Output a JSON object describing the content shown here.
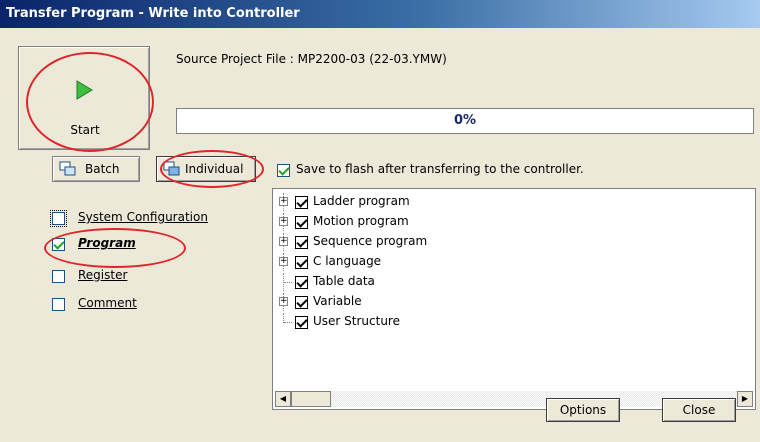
{
  "window": {
    "title": "Transfer Program - Write into Controller"
  },
  "start": {
    "label": "Start",
    "icon": "play-icon"
  },
  "source": {
    "text": "Source Project File : MP2200-03    (22-03.YMW)"
  },
  "progress": {
    "value_text": "0%",
    "value": 0
  },
  "modes": {
    "batch_label": "Batch",
    "individual_label": "Individual"
  },
  "save_to_flash": {
    "label": "Save to flash after transferring to the controller.",
    "checked": true
  },
  "side_items": [
    {
      "label": "System Configuration",
      "checked": false
    },
    {
      "label": "Program",
      "checked": true
    },
    {
      "label": "Register",
      "checked": false
    },
    {
      "label": "Comment",
      "checked": false
    }
  ],
  "tree": [
    {
      "label": "Ladder program",
      "expandable": true,
      "checked": true
    },
    {
      "label": "Motion program",
      "expandable": true,
      "checked": true
    },
    {
      "label": "Sequence program",
      "expandable": true,
      "checked": true
    },
    {
      "label": "C language",
      "expandable": true,
      "checked": true
    },
    {
      "label": "Table data",
      "expandable": false,
      "checked": true
    },
    {
      "label": "Variable",
      "expandable": true,
      "checked": true
    },
    {
      "label": "User Structure",
      "expandable": false,
      "checked": true
    }
  ],
  "buttons": {
    "options": "Options",
    "close": "Close"
  },
  "colors": {
    "annotation": "#e0262a",
    "title_start": "#0a246a",
    "progress_text": "#1b2a6a"
  }
}
